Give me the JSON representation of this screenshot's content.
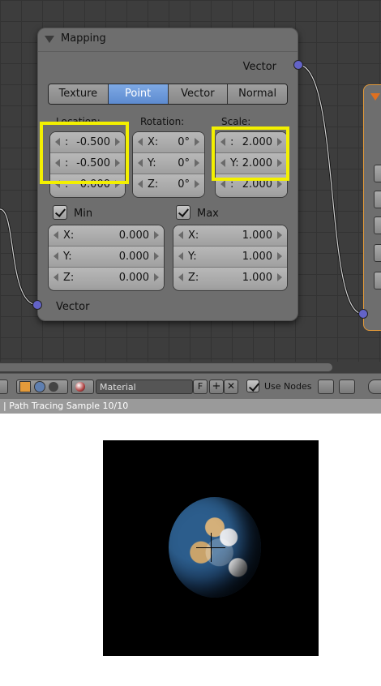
{
  "node": {
    "title": "Mapping",
    "output_socket_label": "Vector",
    "input_socket_label": "Vector",
    "tabs": [
      {
        "label": "Texture",
        "active": false
      },
      {
        "label": "Point",
        "active": true
      },
      {
        "label": "Vector",
        "active": false
      },
      {
        "label": "Normal",
        "active": false
      }
    ],
    "location": {
      "label": "Location:",
      "rows": [
        {
          "axis": ":",
          "value": "-0.500"
        },
        {
          "axis": ":",
          "value": "-0.500"
        },
        {
          "axis": ":",
          "value": "0.000"
        }
      ]
    },
    "rotation": {
      "label": "Rotation:",
      "rows": [
        {
          "axis": "X:",
          "value": "0°"
        },
        {
          "axis": "Y:",
          "value": "0°"
        },
        {
          "axis": "Z:",
          "value": "0°"
        }
      ]
    },
    "scale": {
      "label": "Scale:",
      "rows": [
        {
          "axis": ":",
          "value": "2.000"
        },
        {
          "axis": "Y:",
          "value": "2.000"
        },
        {
          "axis": ":",
          "value": "2.000"
        }
      ]
    },
    "min": {
      "label": "Min",
      "checked": true,
      "rows": [
        {
          "axis": "X:",
          "value": "0.000"
        },
        {
          "axis": "Y:",
          "value": "0.000"
        },
        {
          "axis": "Z:",
          "value": "0.000"
        }
      ]
    },
    "max": {
      "label": "Max",
      "checked": true,
      "rows": [
        {
          "axis": "X:",
          "value": "1.000"
        },
        {
          "axis": "Y:",
          "value": "1.000"
        },
        {
          "axis": "Z:",
          "value": "1.000"
        }
      ]
    },
    "highlight_color": "#f3f000",
    "socket_color": "#6363c7"
  },
  "header_bar": {
    "material_name": "Material",
    "f_label": "F",
    "use_nodes_label": "Use Nodes",
    "use_nodes_checked": true
  },
  "info_bar": {
    "text": "| Path Tracing Sample 10/10"
  }
}
